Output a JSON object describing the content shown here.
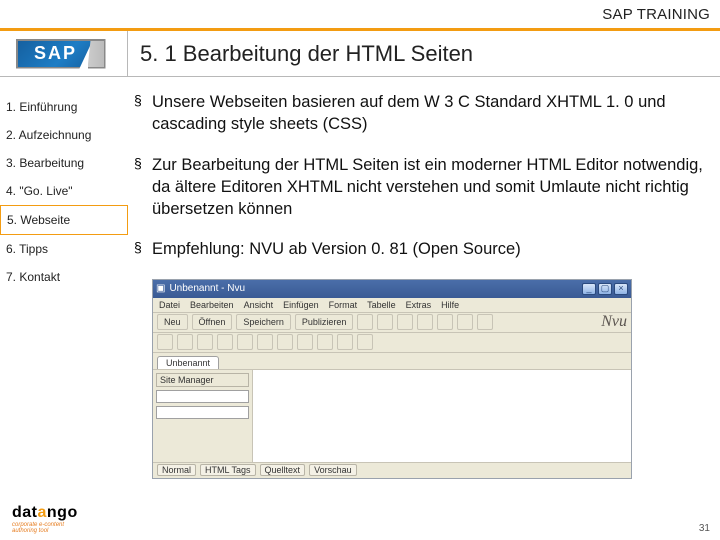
{
  "header": {
    "app": "SAP TRAINING",
    "title": "5. 1 Bearbeitung der HTML Seiten"
  },
  "logo": {
    "text": "SAP"
  },
  "nav": {
    "items": [
      {
        "label": "1. Einführung"
      },
      {
        "label": "2. Aufzeichnung"
      },
      {
        "label": "3. Bearbeitung"
      },
      {
        "label": "4. \"Go. Live\""
      },
      {
        "label": "5. Webseite"
      },
      {
        "label": "6. Tipps"
      },
      {
        "label": "7. Kontakt"
      }
    ],
    "active_index": 4
  },
  "bullets": [
    "Unsere Webseiten basieren auf dem W 3 C Standard XHTML 1. 0 und cascading style sheets (CSS)",
    "Zur Bearbeitung der HTML Seiten ist ein moderner HTML Editor notwendig, da ältere Editoren XHTML nicht verstehen und somit Umlaute nicht richtig übersetzen können",
    "Empfehlung:  NVU ab Version 0. 81 (Open Source)"
  ],
  "editor": {
    "title": "Unbenannt - Nvu",
    "menus": [
      "Datei",
      "Bearbeiten",
      "Ansicht",
      "Einfügen",
      "Format",
      "Tabelle",
      "Extras",
      "Hilfe"
    ],
    "tab": "Unbenannt",
    "brand": "Nvu",
    "side_label": "Site Manager",
    "mode_buttons": [
      "Normal",
      "HTML Tags",
      "Quelltext",
      "Vorschau"
    ],
    "toolbar_labels": [
      "Neu",
      "Öffnen",
      "Speichern",
      "Publizieren"
    ]
  },
  "footer": {
    "brand1": "dat",
    "brand2": "a",
    "brand3": "ngo",
    "tag1": "corporate e-content",
    "tag2": "authoring tool",
    "page_number": "31"
  }
}
